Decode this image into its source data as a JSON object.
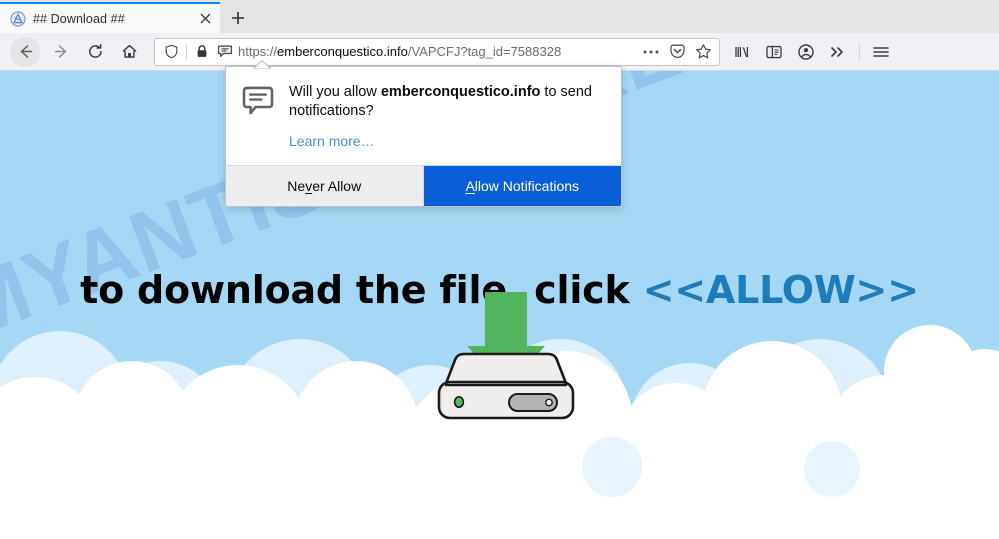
{
  "browser": {
    "tab": {
      "title": "## Download ##",
      "favicon_name": "site-favicon",
      "close_label": "×",
      "newtab_label": "+"
    },
    "nav": {
      "back_label": "←",
      "forward_label": "→",
      "reload_label": "↻",
      "home_label": "⌂"
    },
    "urlbar": {
      "scheme": "https://",
      "host": "emberconquestico.info",
      "path": "/VAPCFJ?tag_id=7588328",
      "shield_icon": "tracking-protection-shield-icon",
      "lock_icon": "padlock-icon",
      "permission_icon": "notification-permission-icon",
      "pageactions_label": "⋯",
      "pocket_icon": "pocket-icon",
      "bookmark_icon": "star-icon"
    },
    "toolbar_right": {
      "library_icon": "library-icon",
      "sidebar_icon": "sidebar-icon",
      "account_icon": "account-avatar-icon",
      "overflow_label": "»",
      "menu_icon": "hamburger-menu-icon"
    }
  },
  "doorhanger": {
    "icon_name": "chat-bubble-notification-icon",
    "question_prefix": "Will you allow ",
    "question_host": "emberconquestico.info",
    "question_suffix": " to send notifications?",
    "learn_more": "Learn more…",
    "never_allow": {
      "prefix": "Ne",
      "accesskey": "v",
      "suffix": "er Allow"
    },
    "allow": {
      "accesskey": "A",
      "suffix": "llow Notifications"
    },
    "primary_color": "#0a5fd8",
    "secondary_color": "#ededf0"
  },
  "page": {
    "watermark": "MYANTISPYWARE.COM",
    "headline_plain": "to download the file, click ",
    "headline_accent": "<<ALLOW>>",
    "headline_accent_color": "#1d7cb9",
    "sky_color": "#a5d8f5",
    "cloud_color": "#ffffff",
    "cloud_shade_color": "#e4f3fd",
    "illustration": {
      "name": "hard-drive-download-icon",
      "arrow_color": "#52b55e",
      "drive_body_color": "#efeeec",
      "drive_outline_color": "#1a1a1a",
      "led_color": "#5cb85c",
      "slot_color": "#b3b3b3"
    }
  }
}
